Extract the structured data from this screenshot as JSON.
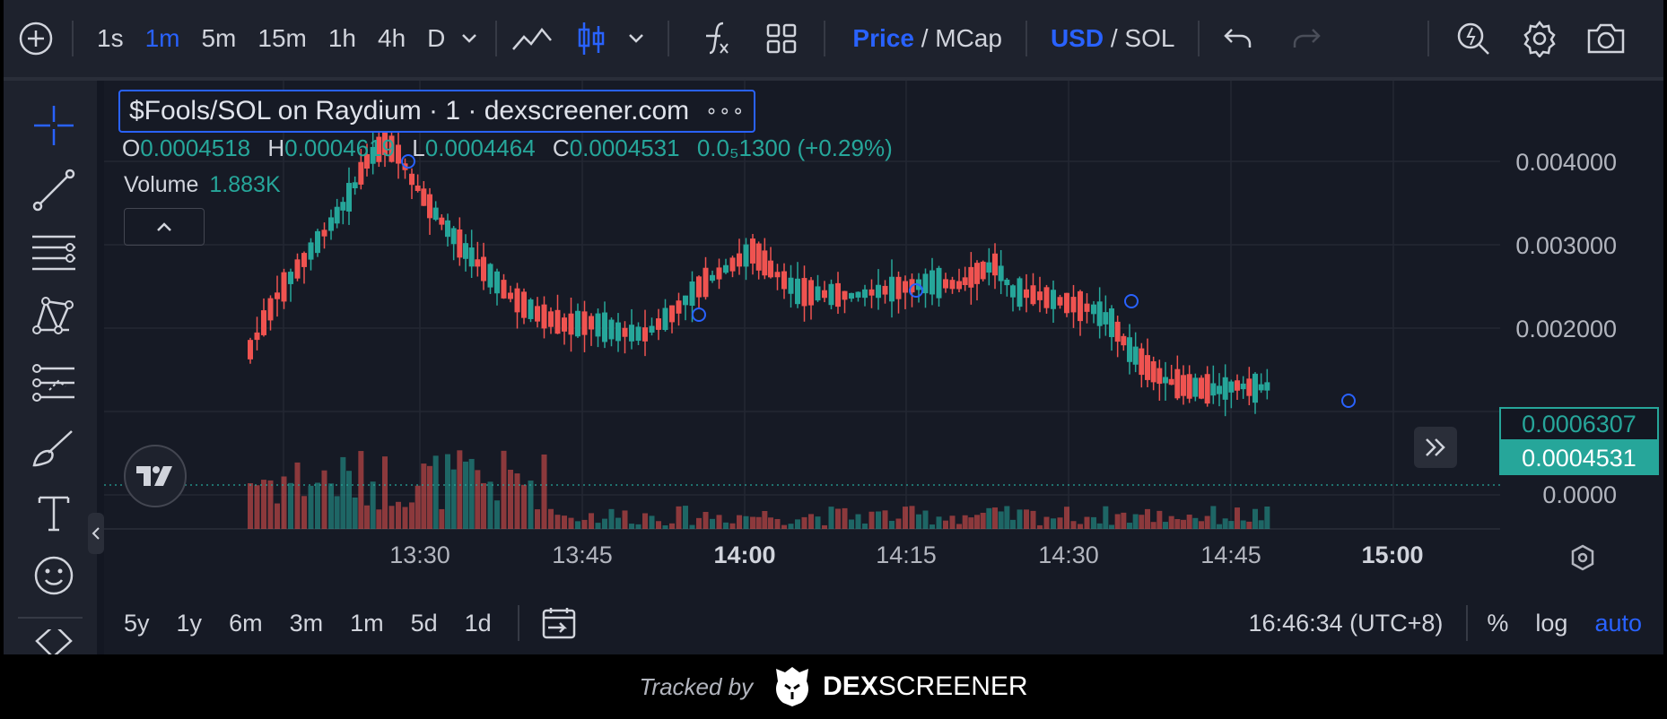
{
  "toolbar": {
    "intervals": [
      "1s",
      "1m",
      "5m",
      "15m",
      "1h",
      "4h",
      "D"
    ],
    "active_interval": "1m",
    "price_label": "Price",
    "mcap_label": "MCap",
    "usd_label": "USD",
    "sol_label": "SOL",
    "slash": "/"
  },
  "legend": {
    "title": "$Fools/SOL on Raydium · 1 · dexscreener.com",
    "more": "∘∘∘",
    "o_label": "O",
    "o_value": "0.0004518",
    "h_label": "H",
    "h_value": "0.0004619",
    "l_label": "L",
    "l_value": "0.0004464",
    "c_label": "C",
    "c_value": "0.0004531",
    "change": "0.0₅1300 (+0.29%)",
    "volume_label": "Volume",
    "volume_value": "1.883K"
  },
  "price_axis": [
    "0.004000",
    "0.003000",
    "0.002000",
    "0.0000"
  ],
  "price_tags": {
    "prev": "0.0006307",
    "last": "0.0004531"
  },
  "time_axis": [
    {
      "label": "13:30",
      "bold": false
    },
    {
      "label": "13:45",
      "bold": false
    },
    {
      "label": "14:00",
      "bold": true
    },
    {
      "label": "14:15",
      "bold": false
    },
    {
      "label": "14:30",
      "bold": false
    },
    {
      "label": "14:45",
      "bold": false
    },
    {
      "label": "15:00",
      "bold": true
    }
  ],
  "ranges": [
    "5y",
    "1y",
    "6m",
    "3m",
    "1m",
    "5d",
    "1d"
  ],
  "clock": "16:46:34 (UTC+8)",
  "scale_options": {
    "percent": "%",
    "log": "log",
    "auto": "auto"
  },
  "footer": {
    "tracked_by": "Tracked by",
    "brand_bold": "DEX",
    "brand": "SCREENER"
  },
  "colors": {
    "up": "#26a69a",
    "down": "#ef5350",
    "accent": "#2962ff",
    "bg": "#131722"
  }
}
